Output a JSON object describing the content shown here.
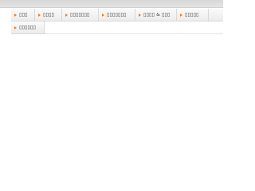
{
  "nav": {
    "items": [
      {
        "label": "▯▯▯"
      },
      {
        "label": "▯▯▯▯"
      },
      {
        "label": "▯▯▯▯▯▯▯"
      },
      {
        "label": "▯▯▯▯▯▯▯"
      },
      {
        "label": "▯▯▯▯ & ▯▯▯"
      },
      {
        "label": "▯▯▯▯▯"
      },
      {
        "label": ""
      },
      {
        "label": "▯▯▯▯▯▯"
      }
    ],
    "bullet_color": "#f07a12"
  }
}
